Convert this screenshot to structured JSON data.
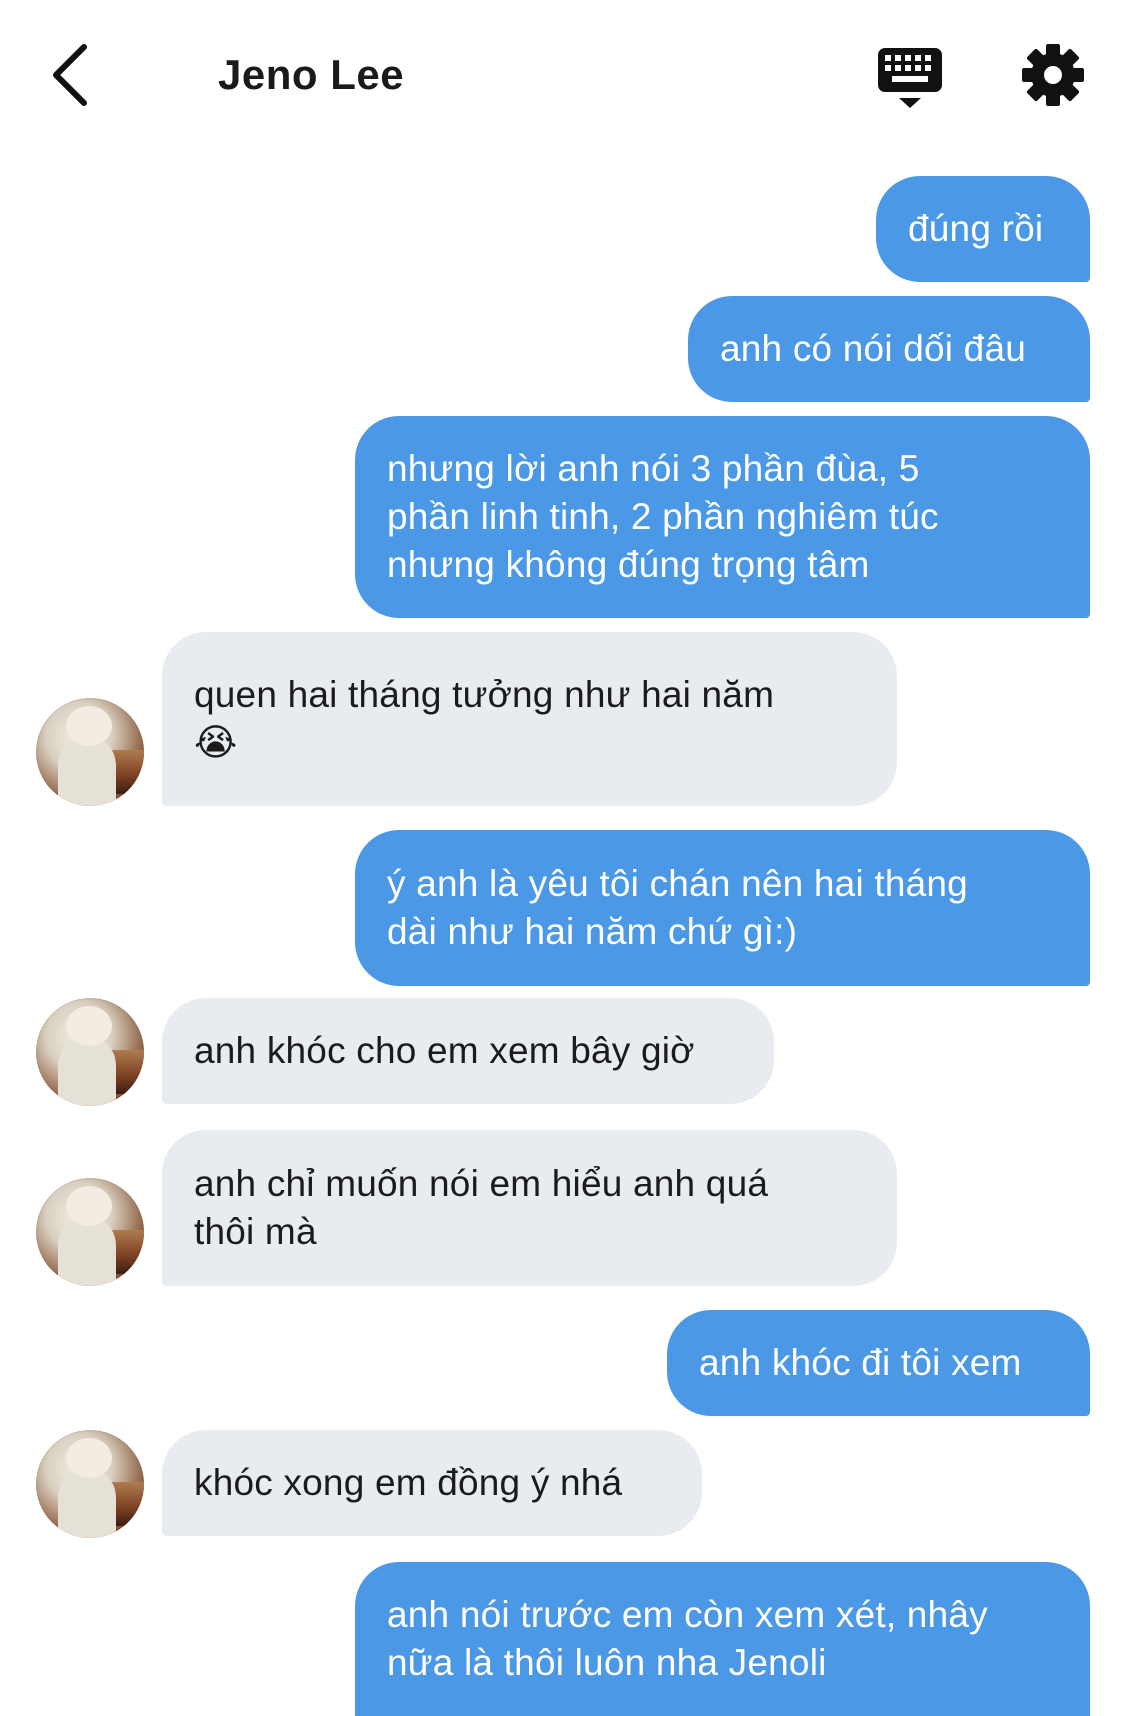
{
  "header": {
    "back_icon": "chevron-left-icon",
    "title": "Jeno Lee",
    "keyboard_icon": "keyboard-icon",
    "settings_icon": "gear-icon"
  },
  "colors": {
    "sent_bubble": "#4a98e6",
    "received_bubble": "#e8ebef",
    "sent_text": "#ffffff",
    "received_text": "#1b1b1b"
  },
  "messages": [
    {
      "from": "me",
      "text": "đúng rồi"
    },
    {
      "from": "me",
      "text": "anh có nói dối đâu"
    },
    {
      "from": "me",
      "lines": [
        "nhưng lời anh nói 3 phần đùa, 5",
        "phần linh tinh, 2 phần nghiêm túc",
        "nhưng không đúng trọng tâm"
      ]
    },
    {
      "from": "them",
      "lines": [
        "quen hai tháng tưởng như hai năm",
        "😭"
      ]
    },
    {
      "from": "me",
      "lines": [
        "ý anh là yêu tôi chán nên hai tháng",
        "dài như hai năm chứ gì:)"
      ]
    },
    {
      "from": "them",
      "text": "anh khóc cho em xem bây giờ"
    },
    {
      "from": "them",
      "lines": [
        "anh chỉ muốn nói em hiểu anh quá",
        "thôi mà"
      ]
    },
    {
      "from": "me",
      "text": "anh khóc đi tôi xem"
    },
    {
      "from": "them",
      "text": "khóc xong em đồng ý nhá"
    },
    {
      "from": "me",
      "lines": [
        "anh nói trước em còn xem xét, nhây",
        "nữa là thôi luôn nha Jenoli"
      ]
    }
  ]
}
